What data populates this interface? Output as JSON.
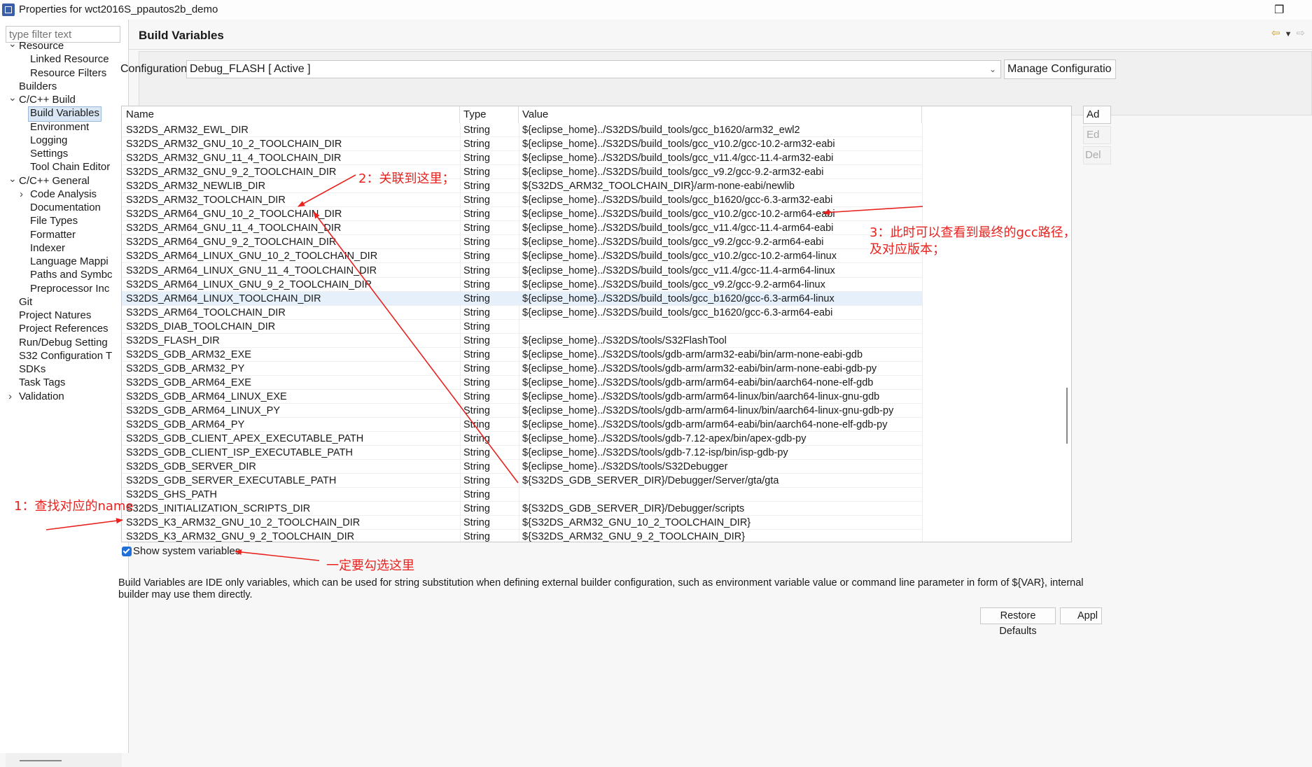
{
  "window": {
    "title": "Properties for wct2016S_ppautos2b_demo",
    "restore_icon": "restore-window-icon"
  },
  "sidebar": {
    "filter_placeholder": "type filter text",
    "tree": [
      {
        "label": "Resource",
        "level": 0,
        "twisty": "expanded"
      },
      {
        "label": "Linked Resource",
        "level": 1
      },
      {
        "label": "Resource Filters",
        "level": 1
      },
      {
        "label": "Builders",
        "level": 0
      },
      {
        "label": "C/C++ Build",
        "level": 0,
        "twisty": "expanded"
      },
      {
        "label": "Build Variables",
        "level": 1,
        "selected": true
      },
      {
        "label": "Environment",
        "level": 1
      },
      {
        "label": "Logging",
        "level": 1
      },
      {
        "label": "Settings",
        "level": 1
      },
      {
        "label": "Tool Chain Editor",
        "level": 1
      },
      {
        "label": "C/C++ General",
        "level": 0,
        "twisty": "expanded"
      },
      {
        "label": "Code Analysis",
        "level": 1,
        "twisty": "collapsed"
      },
      {
        "label": "Documentation",
        "level": 1
      },
      {
        "label": "File Types",
        "level": 1
      },
      {
        "label": "Formatter",
        "level": 1
      },
      {
        "label": "Indexer",
        "level": 1
      },
      {
        "label": "Language Mappi",
        "level": 1
      },
      {
        "label": "Paths and Symbc",
        "level": 1
      },
      {
        "label": "Preprocessor Inc",
        "level": 1
      },
      {
        "label": "Git",
        "level": 0
      },
      {
        "label": "Project Natures",
        "level": 0
      },
      {
        "label": "Project References",
        "level": 0
      },
      {
        "label": "Run/Debug Setting",
        "level": 0
      },
      {
        "label": "S32 Configuration T",
        "level": 0
      },
      {
        "label": "SDKs",
        "level": 0
      },
      {
        "label": "Task Tags",
        "level": 0
      },
      {
        "label": "Validation",
        "level": 0,
        "twisty": "collapsed"
      }
    ]
  },
  "main": {
    "heading": "Build Variables",
    "nav_icons": [
      "back-arrow-icon",
      "dropdown-icon",
      "forward-arrow-icon"
    ],
    "configuration": {
      "label": "Configuration:",
      "value": "Debug_FLASH  [ Active ]",
      "manage_button": "Manage Configuratio"
    },
    "table": {
      "columns": [
        "Name",
        "Type",
        "Value"
      ],
      "rows": [
        [
          "S32DS_ARM32_EWL_DIR",
          "String",
          "${eclipse_home}../S32DS/build_tools/gcc_b1620/arm32_ewl2"
        ],
        [
          "S32DS_ARM32_GNU_10_2_TOOLCHAIN_DIR",
          "String",
          "${eclipse_home}../S32DS/build_tools/gcc_v10.2/gcc-10.2-arm32-eabi"
        ],
        [
          "S32DS_ARM32_GNU_11_4_TOOLCHAIN_DIR",
          "String",
          "${eclipse_home}../S32DS/build_tools/gcc_v11.4/gcc-11.4-arm32-eabi"
        ],
        [
          "S32DS_ARM32_GNU_9_2_TOOLCHAIN_DIR",
          "String",
          "${eclipse_home}../S32DS/build_tools/gcc_v9.2/gcc-9.2-arm32-eabi"
        ],
        [
          "S32DS_ARM32_NEWLIB_DIR",
          "String",
          "${S32DS_ARM32_TOOLCHAIN_DIR}/arm-none-eabi/newlib"
        ],
        [
          "S32DS_ARM32_TOOLCHAIN_DIR",
          "String",
          "${eclipse_home}../S32DS/build_tools/gcc_b1620/gcc-6.3-arm32-eabi"
        ],
        [
          "S32DS_ARM64_GNU_10_2_TOOLCHAIN_DIR",
          "String",
          "${eclipse_home}../S32DS/build_tools/gcc_v10.2/gcc-10.2-arm64-eabi"
        ],
        [
          "S32DS_ARM64_GNU_11_4_TOOLCHAIN_DIR",
          "String",
          "${eclipse_home}../S32DS/build_tools/gcc_v11.4/gcc-11.4-arm64-eabi"
        ],
        [
          "S32DS_ARM64_GNU_9_2_TOOLCHAIN_DIR",
          "String",
          "${eclipse_home}../S32DS/build_tools/gcc_v9.2/gcc-9.2-arm64-eabi"
        ],
        [
          "S32DS_ARM64_LINUX_GNU_10_2_TOOLCHAIN_DIR",
          "String",
          "${eclipse_home}../S32DS/build_tools/gcc_v10.2/gcc-10.2-arm64-linux"
        ],
        [
          "S32DS_ARM64_LINUX_GNU_11_4_TOOLCHAIN_DIR",
          "String",
          "${eclipse_home}../S32DS/build_tools/gcc_v11.4/gcc-11.4-arm64-linux"
        ],
        [
          "S32DS_ARM64_LINUX_GNU_9_2_TOOLCHAIN_DIR",
          "String",
          "${eclipse_home}../S32DS/build_tools/gcc_v9.2/gcc-9.2-arm64-linux"
        ],
        [
          "S32DS_ARM64_LINUX_TOOLCHAIN_DIR",
          "String",
          "${eclipse_home}../S32DS/build_tools/gcc_b1620/gcc-6.3-arm64-linux"
        ],
        [
          "S32DS_ARM64_TOOLCHAIN_DIR",
          "String",
          "${eclipse_home}../S32DS/build_tools/gcc_b1620/gcc-6.3-arm64-eabi"
        ],
        [
          "S32DS_DIAB_TOOLCHAIN_DIR",
          "String",
          ""
        ],
        [
          "S32DS_FLASH_DIR",
          "String",
          "${eclipse_home}../S32DS/tools/S32FlashTool"
        ],
        [
          "S32DS_GDB_ARM32_EXE",
          "String",
          "${eclipse_home}../S32DS/tools/gdb-arm/arm32-eabi/bin/arm-none-eabi-gdb"
        ],
        [
          "S32DS_GDB_ARM32_PY",
          "String",
          "${eclipse_home}../S32DS/tools/gdb-arm/arm32-eabi/bin/arm-none-eabi-gdb-py"
        ],
        [
          "S32DS_GDB_ARM64_EXE",
          "String",
          "${eclipse_home}../S32DS/tools/gdb-arm/arm64-eabi/bin/aarch64-none-elf-gdb"
        ],
        [
          "S32DS_GDB_ARM64_LINUX_EXE",
          "String",
          "${eclipse_home}../S32DS/tools/gdb-arm/arm64-linux/bin/aarch64-linux-gnu-gdb"
        ],
        [
          "S32DS_GDB_ARM64_LINUX_PY",
          "String",
          "${eclipse_home}../S32DS/tools/gdb-arm/arm64-linux/bin/aarch64-linux-gnu-gdb-py"
        ],
        [
          "S32DS_GDB_ARM64_PY",
          "String",
          "${eclipse_home}../S32DS/tools/gdb-arm/arm64-eabi/bin/aarch64-none-elf-gdb-py"
        ],
        [
          "S32DS_GDB_CLIENT_APEX_EXECUTABLE_PATH",
          "String",
          "${eclipse_home}../S32DS/tools/gdb-7.12-apex/bin/apex-gdb-py"
        ],
        [
          "S32DS_GDB_CLIENT_ISP_EXECUTABLE_PATH",
          "String",
          "${eclipse_home}../S32DS/tools/gdb-7.12-isp/bin/isp-gdb-py"
        ],
        [
          "S32DS_GDB_SERVER_DIR",
          "String",
          "${eclipse_home}../S32DS/tools/S32Debugger"
        ],
        [
          "S32DS_GDB_SERVER_EXECUTABLE_PATH",
          "String",
          "${S32DS_GDB_SERVER_DIR}/Debugger/Server/gta/gta"
        ],
        [
          "S32DS_GHS_PATH",
          "String",
          ""
        ],
        [
          "S32DS_INITIALIZATION_SCRIPTS_DIR",
          "String",
          "${S32DS_GDB_SERVER_DIR}/Debugger/scripts"
        ],
        [
          "S32DS_K3_ARM32_GNU_10_2_TOOLCHAIN_DIR",
          "String",
          "${S32DS_ARM32_GNU_10_2_TOOLCHAIN_DIR}"
        ],
        [
          "S32DS_K3_ARM32_GNU_9_2_TOOLCHAIN_DIR",
          "String",
          "${S32DS_ARM32_GNU_9_2_TOOLCHAIN_DIR}"
        ]
      ],
      "highlighted_row": 12
    },
    "side_buttons": [
      "Ad",
      "Ed",
      "Del"
    ],
    "show_system_variables": {
      "label": "Show system variables",
      "checked": true
    },
    "description": "Build Variables are IDE only variables, which can be used for string substitution when defining external builder configuration, such as environment variable value or command line parameter in form of ${VAR}, internal builder may use them directly.",
    "restore_defaults": "Restore Defaults",
    "apply": "Appl"
  },
  "annotations": {
    "a1": "1：查找对应的name",
    "a2": "2：关联到这里；",
    "a3_line1": "3：此时可以查看到最终的gcc路径，",
    "a3_line2": "及对应版本；",
    "a4": "一定要勾选这里",
    "color": "#e8231f"
  }
}
